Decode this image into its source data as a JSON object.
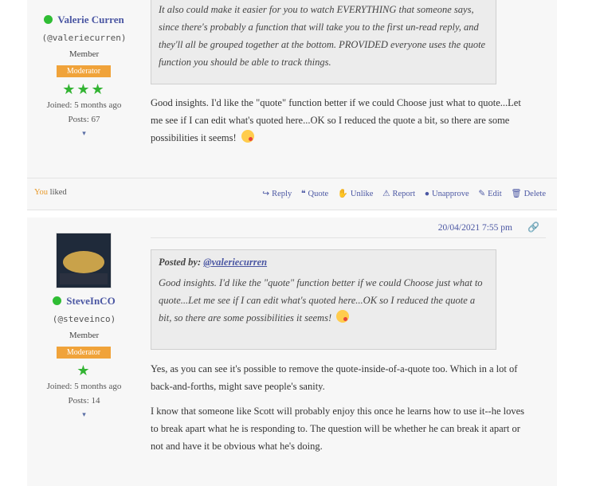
{
  "post1": {
    "author_name": "Valerie Curren",
    "handle": "(@valeriecurren)",
    "role": "Member",
    "badge": "Moderator",
    "stars": "★★★",
    "joined": "Joined: 5 months ago",
    "posts": "Posts: 67",
    "chevron": "▾",
    "quote_text": "It also could make it easier for you to watch EVERYTHING that someone says, since there's probably a function that will take you to the first un-read reply, and they'll all be grouped together at the bottom.  PROVIDED everyone uses the quote function you should be able to track things.",
    "body": "Good insights.  I'd like the \"quote\" function better if we could Choose just what to quote...Let me see if I can edit what's quoted here...OK so I reduced the quote a bit, so there are some possibilities it seems!",
    "liked_you": "You",
    "liked_text": " liked",
    "actions": {
      "reply": "Reply",
      "quote": "Quote",
      "unlike": "Unlike",
      "report": "Report",
      "unapprove": "Unapprove",
      "edit": "Edit",
      "delete": "Delete"
    }
  },
  "post2": {
    "date": "20/04/2021 7:55 pm",
    "author_name": "SteveInCO",
    "handle": "(@steveinco)",
    "role": "Member",
    "badge": "Moderator",
    "stars": "★",
    "joined": "Joined: 5 months ago",
    "posts": "Posts: 14",
    "chevron": "▾",
    "quote_label": "Posted by: ",
    "quote_author": "@valeriecurren",
    "quote_text": "Good insights.  I'd like the \"quote\" function better if we could Choose just what to quote...Let me see if I can edit what's quoted here...OK so I reduced the quote a bit, so there are some possibilities it seems!",
    "body1": "Yes, as you can see it's possible to remove the quote-inside-of-a-quote too.  Which in a lot of back-and-forths, might save people's sanity.",
    "body2": "I know that someone like Scott will probably enjoy this once he learns how to use it--he loves to break apart what he is responding to.  The question will be whether he can break it apart or not and have it be obvious what he's doing."
  },
  "colors": {
    "accent": "#4b57a3",
    "online": "#2fbd34",
    "badge": "#f0a33a",
    "star": "#33b433",
    "you": "#e89a2b"
  },
  "icons": {
    "reply": "reply-icon",
    "quote": "quote-icon",
    "unlike": "thumbs-down-icon",
    "report": "warning-icon",
    "unapprove": "info-circle-icon",
    "edit": "edit-icon",
    "delete": "trash-icon",
    "link": "link-icon"
  }
}
